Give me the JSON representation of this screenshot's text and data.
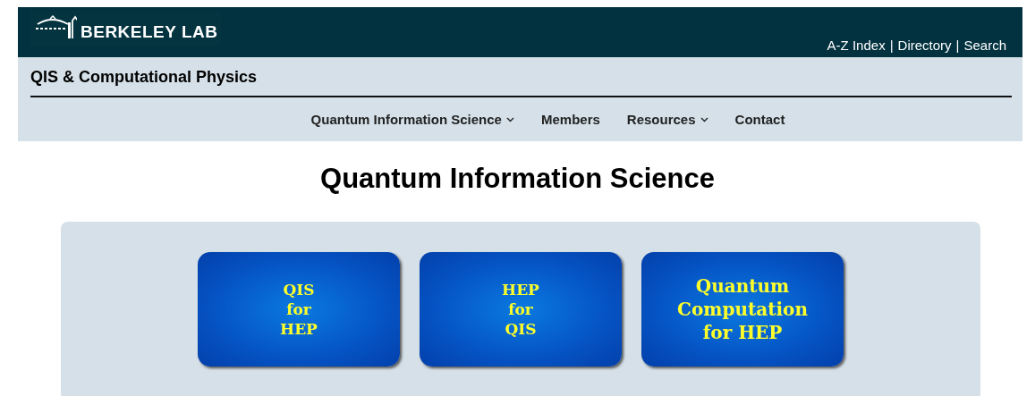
{
  "header": {
    "logo_text": "BERKELEY LAB",
    "links": [
      {
        "label": "A-Z Index"
      },
      {
        "label": "Directory"
      },
      {
        "label": "Search"
      }
    ],
    "separator": "|"
  },
  "site_title": "QIS & Computational Physics",
  "nav": [
    {
      "label": "Quantum Information Science",
      "dropdown": true
    },
    {
      "label": "Members",
      "dropdown": false
    },
    {
      "label": "Resources",
      "dropdown": true
    },
    {
      "label": "Contact",
      "dropdown": false
    }
  ],
  "page_title": "Quantum Information Science",
  "tiles": [
    {
      "lines": [
        "QIS",
        "for",
        "HEP"
      ],
      "kind": "small"
    },
    {
      "lines": [
        "HEP",
        "for",
        "QIS"
      ],
      "kind": "small"
    },
    {
      "lines": [
        "Quantum",
        "Computation",
        "for HEP"
      ],
      "kind": "large"
    }
  ]
}
